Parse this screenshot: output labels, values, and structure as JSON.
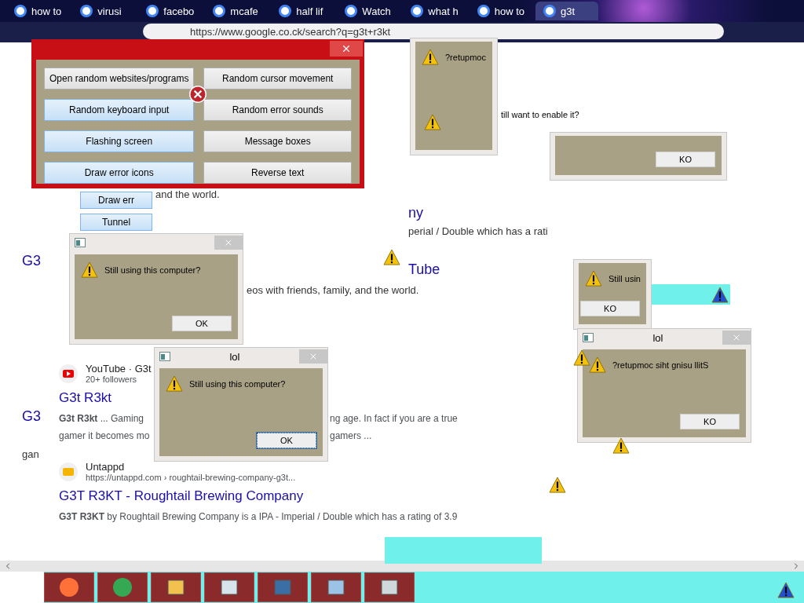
{
  "browser": {
    "tabs": [
      {
        "label": "how to",
        "selected": false
      },
      {
        "label": "virusi",
        "selected": false
      },
      {
        "label": "facebo",
        "selected": false
      },
      {
        "label": "mcafe",
        "selected": false
      },
      {
        "label": "half lif",
        "selected": false
      },
      {
        "label": "Watch",
        "selected": false
      },
      {
        "label": "what h",
        "selected": false
      },
      {
        "label": "how to",
        "selected": false
      },
      {
        "label": "g3t",
        "selected": true
      }
    ],
    "url": "https://www.google.co.ck/search?q=g3t+r3kt"
  },
  "results": [
    {
      "source": "YouTube · G3t",
      "meta": "20+ followers",
      "title": "G3t R3kt",
      "snippet_lines": [
        [
          "**G3t R3kt** ... Gaming",
          "ng age. In fact if you are a true"
        ],
        [
          "gamer it becomes mo",
          "gamers ..."
        ]
      ]
    },
    {
      "source": "Untappd",
      "meta": "https://untappd.com › roughtail-brewing-company-g3t...",
      "title": "G3T R3KT - Roughtail Brewing Company",
      "snippet_lines": [
        [
          "**G3T R3KT** by Roughtail Brewing Company is a IPA - Imperial / Double which has a rating of 3.9"
        ]
      ]
    }
  ],
  "fragments": [
    {
      "kind": "body",
      "text": "and the world."
    },
    {
      "kind": "link",
      "text": "ny"
    },
    {
      "kind": "body",
      "text": "perial / Double which has a rati"
    },
    {
      "kind": "link",
      "text": "G3"
    },
    {
      "kind": "link",
      "text": "Tube"
    },
    {
      "kind": "body",
      "text": "eos with friends, family, and the world."
    },
    {
      "kind": "link",
      "text": "G3"
    },
    {
      "kind": "body",
      "text": "gan"
    }
  ],
  "control_panel": {
    "buttons": [
      {
        "label": "Open random websites/programs",
        "active": false
      },
      {
        "label": "Random cursor movement",
        "active": false
      },
      {
        "label": "Random keyboard input",
        "active": true
      },
      {
        "label": "Random error sounds",
        "active": false
      },
      {
        "label": "Flashing screen",
        "active": true
      },
      {
        "label": "Message boxes",
        "active": false
      },
      {
        "label": "Draw error icons",
        "active": true
      },
      {
        "label": "Reverse text",
        "active": false
      }
    ],
    "stray_buttons": [
      "Draw err",
      "Tunnel"
    ]
  },
  "dialogs": [
    {
      "message": "Still using this computer?",
      "button": "OK",
      "focused": false
    },
    {
      "title": "lol",
      "message": "Still using this computer?",
      "button": "OK",
      "focused": true
    },
    {
      "message": "?retupmoc"
    },
    {
      "message": "Still usin",
      "button": "KO",
      "focused": false
    },
    {
      "button": "KO",
      "focused": false
    },
    {
      "title": "lol",
      "message": "?retupmoc siht gnisu llitS",
      "button": "KO",
      "focused": false
    }
  ],
  "notice": "till want to enable it?"
}
